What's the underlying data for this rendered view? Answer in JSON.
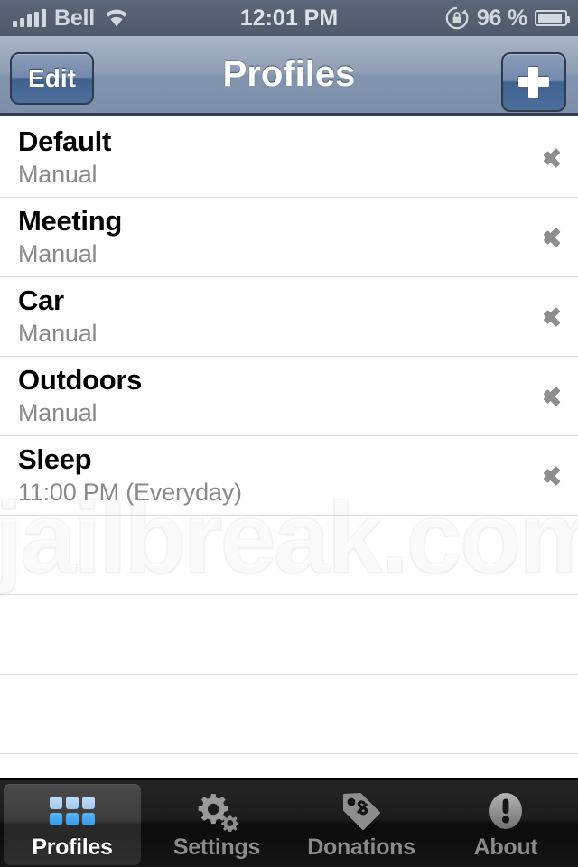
{
  "status_bar": {
    "carrier": "Bell",
    "signal_bars": 5,
    "wifi_icon": "wifi-icon",
    "time": "12:01 PM",
    "rotation_lock_icon": "rotation-lock-icon",
    "battery_percent": "96 %",
    "battery_icon": "battery-icon"
  },
  "nav_bar": {
    "edit_label": "Edit",
    "title": "Profiles",
    "add_label": "+"
  },
  "list": {
    "rows": [
      {
        "title": "Default",
        "subtitle": "Manual",
        "chevron": "chevron-right-icon"
      },
      {
        "title": "Meeting",
        "subtitle": "Manual",
        "chevron": "chevron-right-icon"
      },
      {
        "title": "Car",
        "subtitle": "Manual",
        "chevron": "chevron-right-icon"
      },
      {
        "title": "Outdoors",
        "subtitle": "Manual",
        "chevron": "chevron-right-icon"
      },
      {
        "title": "Sleep",
        "subtitle": "11:00 PM (Everyday)",
        "chevron": "chevron-right-icon"
      }
    ],
    "empty_rows": 3
  },
  "watermark": {
    "text": "jailbreak.com"
  },
  "tab_bar": {
    "tabs": [
      {
        "label": "Profiles",
        "icon": "grid-icon",
        "active": true
      },
      {
        "label": "Settings",
        "icon": "gears-icon",
        "active": false
      },
      {
        "label": "Donations",
        "icon": "price-tag-icon",
        "active": false
      },
      {
        "label": "About",
        "icon": "exclamation-circle-icon",
        "active": false
      }
    ]
  },
  "colors": {
    "status_bar_bg": "#565f70",
    "nav_bar_bg": "#8294ad",
    "accent_blue": "#4d6d9b",
    "tab_bar_bg": "#141414",
    "active_tab_icon": "#2f9ced",
    "row_title": "#000000",
    "row_subtitle": "#8a8a8a"
  }
}
